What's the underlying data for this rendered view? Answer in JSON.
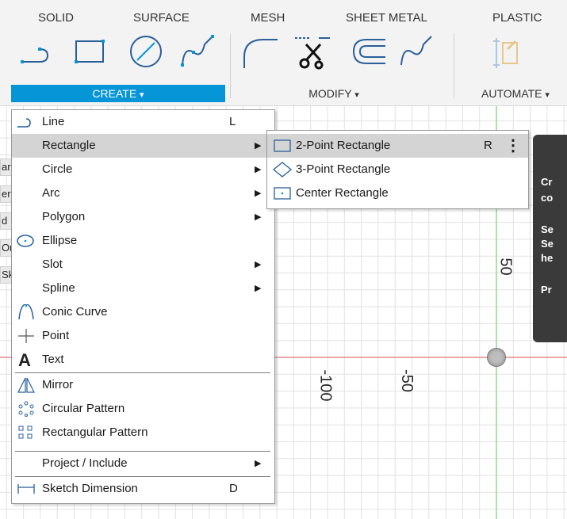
{
  "toolbar": {
    "tabs": [
      "SOLID",
      "SURFACE",
      "MESH",
      "SHEET METAL",
      "PLASTIC"
    ],
    "groups": {
      "create": "CREATE",
      "modify": "MODIFY",
      "automate": "AUTOMATE"
    },
    "dropdown_glyph": "▾",
    "accent_color": "#0696d7"
  },
  "create_menu": {
    "items": [
      {
        "label": "Line",
        "shortcut": "L",
        "icon": "line-icon"
      },
      {
        "label": "Rectangle",
        "submenu": true,
        "highlighted": true
      },
      {
        "label": "Circle",
        "submenu": true
      },
      {
        "label": "Arc",
        "submenu": true
      },
      {
        "label": "Polygon",
        "submenu": true
      },
      {
        "label": "Ellipse",
        "icon": "ellipse-icon"
      },
      {
        "label": "Slot",
        "submenu": true
      },
      {
        "label": "Spline",
        "submenu": true
      },
      {
        "label": "Conic Curve",
        "icon": "conic-curve-icon"
      },
      {
        "label": "Point",
        "icon": "point-icon"
      },
      {
        "label": "Text",
        "icon": "text-icon"
      },
      {
        "label": "Mirror",
        "icon": "mirror-icon"
      },
      {
        "label": "Circular Pattern",
        "icon": "circular-pattern-icon"
      },
      {
        "label": "Rectangular Pattern",
        "icon": "rectangular-pattern-icon"
      },
      {
        "label": "Project / Include",
        "submenu": true
      },
      {
        "label": "Sketch Dimension",
        "shortcut": "D",
        "icon": "sketch-dimension-icon"
      }
    ],
    "arrow_glyph": "▶"
  },
  "rectangle_submenu": {
    "items": [
      {
        "label": "2-Point Rectangle",
        "shortcut": "R",
        "highlighted": true,
        "icon": "two-point-rectangle-icon"
      },
      {
        "label": "3-Point Rectangle",
        "icon": "three-point-rectangle-icon"
      },
      {
        "label": "Center Rectangle",
        "icon": "center-rectangle-icon"
      }
    ],
    "more_glyph": "⋮"
  },
  "canvas": {
    "axis_labels": {
      "y_50": "50",
      "x_neg100": "-100",
      "x_neg50": "-50"
    },
    "grid_color": "#e2e2e2",
    "x_axis_color": "#e88a8a",
    "y_axis_color": "#8fd88f"
  },
  "browser_fragments": [
    "ar",
    "er",
    "d",
    "Ori",
    "Sk"
  ],
  "tooltip_fragments": [
    "Cr",
    "co",
    "Se",
    "Se",
    "he",
    "Pr"
  ]
}
